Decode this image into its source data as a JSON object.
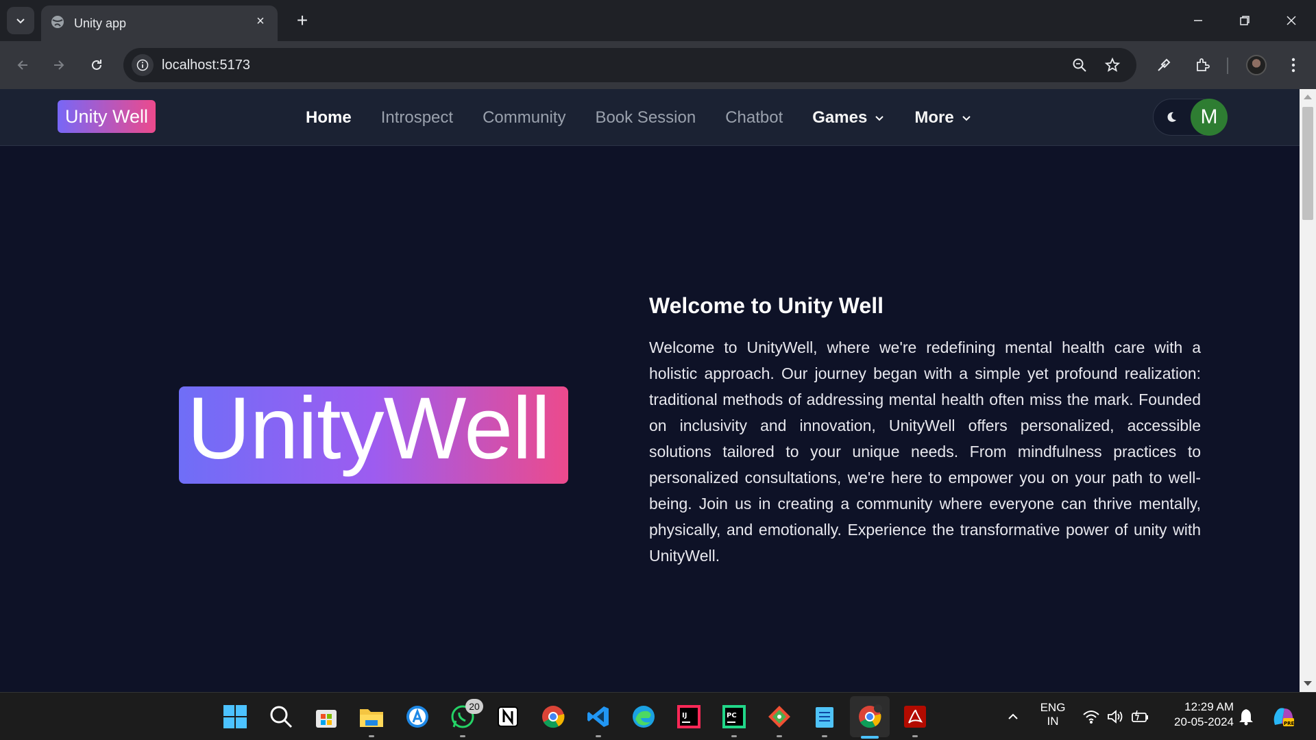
{
  "browser": {
    "tab_title": "Unity app",
    "url": "localhost:5173",
    "new_tab_label": "+",
    "close_tab_label": "×"
  },
  "site": {
    "brand": "Unity Well",
    "nav": [
      {
        "label": "Home",
        "active": true
      },
      {
        "label": "Introspect"
      },
      {
        "label": "Community"
      },
      {
        "label": "Book Session"
      },
      {
        "label": "Chatbot"
      },
      {
        "label": "Games",
        "dropdown": true
      },
      {
        "label": "More",
        "dropdown": true
      }
    ],
    "avatar_initial": "M",
    "theme_toggle_icon": "moon-icon"
  },
  "hero": {
    "logo_text": "UnityWell",
    "title": "Welcome to Unity Well",
    "paragraph": "Welcome to UnityWell, where we're redefining mental health care with a holistic approach. Our journey began with a simple yet profound realization: traditional methods of addressing mental health often miss the mark. Founded on inclusivity and innovation, UnityWell offers personalized, accessible solutions tailored to your unique needs. From mindfulness practices to personalized consultations, we're here to empower you on your path to well-being. Join us in creating a community where everyone can thrive mentally, physically, and emotionally. Experience the transformative power of unity with UnityWell."
  },
  "taskbar": {
    "apps": [
      "start",
      "search",
      "store",
      "file-explorer",
      "app-store",
      "whatsapp",
      "notion",
      "chrome",
      "vscode",
      "edge",
      "intellij",
      "pycharm",
      "git",
      "notepad",
      "chrome-active",
      "acrobat"
    ],
    "whatsapp_badge": "20",
    "lang_line1": "ENG",
    "lang_line2": "IN",
    "time": "12:29 AM",
    "date": "20-05-2024"
  },
  "colors": {
    "page_bg": "#0e1227",
    "nav_bg": "#1b2233",
    "brand_gradient_start": "#7867f6",
    "brand_gradient_end": "#ec4a8c",
    "avatar_bg": "#2e7d32"
  }
}
